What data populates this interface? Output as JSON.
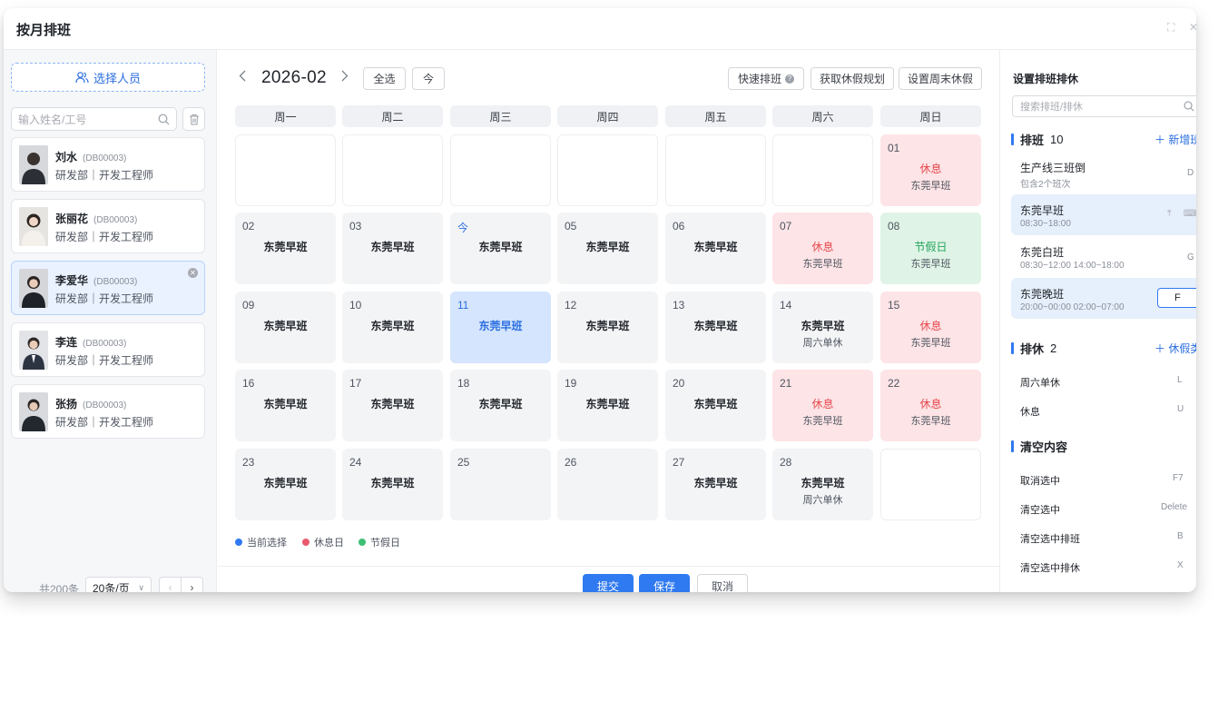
{
  "title": "按月排班",
  "left": {
    "pick_label": "选择人员",
    "search_placeholder": "输入姓名/工号",
    "people": [
      {
        "name": "刘水",
        "code": "(DB00003)",
        "dept": "研发部｜开发工程师"
      },
      {
        "name": "张丽花",
        "code": "(DB00003)",
        "dept": "研发部｜开发工程师"
      },
      {
        "name": "李爱华",
        "code": "(DB00003)",
        "dept": "研发部｜开发工程师"
      },
      {
        "name": "李连",
        "code": "(DB00003)",
        "dept": "研发部｜开发工程师"
      },
      {
        "name": "张扬",
        "code": "(DB00003)",
        "dept": "研发部｜开发工程师"
      }
    ],
    "total": "共200条",
    "per_page": "20条/页"
  },
  "calendar": {
    "month": "2026-02",
    "select_all": "全选",
    "today": "今",
    "quick": "快速排班",
    "get_holiday": "获取休假规划",
    "set_weekend": "设置周末休假",
    "weekdays": [
      "周一",
      "周二",
      "周三",
      "周四",
      "周五",
      "周六",
      "周日"
    ],
    "cells": [
      {
        "date": "",
        "main": "",
        "sub": ""
      },
      {
        "date": "",
        "main": "",
        "sub": ""
      },
      {
        "date": "",
        "main": "",
        "sub": ""
      },
      {
        "date": "",
        "main": "",
        "sub": ""
      },
      {
        "date": "",
        "main": "",
        "sub": ""
      },
      {
        "date": "",
        "main": "",
        "sub": ""
      },
      {
        "date": "01",
        "main": "休息",
        "sub": "东莞早班"
      },
      {
        "date": "02",
        "main": "东莞早班",
        "sub": ""
      },
      {
        "date": "03",
        "main": "东莞早班",
        "sub": ""
      },
      {
        "date": "今",
        "main": "东莞早班",
        "sub": ""
      },
      {
        "date": "05",
        "main": "东莞早班",
        "sub": ""
      },
      {
        "date": "06",
        "main": "东莞早班",
        "sub": ""
      },
      {
        "date": "07",
        "main": "休息",
        "sub": "东莞早班"
      },
      {
        "date": "08",
        "main": "节假日",
        "sub": "东莞早班"
      },
      {
        "date": "09",
        "main": "东莞早班",
        "sub": ""
      },
      {
        "date": "10",
        "main": "东莞早班",
        "sub": ""
      },
      {
        "date": "11",
        "main": "东莞早班",
        "sub": ""
      },
      {
        "date": "12",
        "main": "东莞早班",
        "sub": ""
      },
      {
        "date": "13",
        "main": "东莞早班",
        "sub": ""
      },
      {
        "date": "14",
        "main": "东莞早班",
        "sub": "周六单休"
      },
      {
        "date": "15",
        "main": "休息",
        "sub": "东莞早班"
      },
      {
        "date": "16",
        "main": "东莞早班",
        "sub": ""
      },
      {
        "date": "17",
        "main": "东莞早班",
        "sub": ""
      },
      {
        "date": "18",
        "main": "东莞早班",
        "sub": ""
      },
      {
        "date": "19",
        "main": "东莞早班",
        "sub": ""
      },
      {
        "date": "20",
        "main": "东莞早班",
        "sub": ""
      },
      {
        "date": "21",
        "main": "休息",
        "sub": "东莞早班"
      },
      {
        "date": "22",
        "main": "休息",
        "sub": "东莞早班"
      },
      {
        "date": "23",
        "main": "东莞早班",
        "sub": ""
      },
      {
        "date": "24",
        "main": "东莞早班",
        "sub": ""
      },
      {
        "date": "25",
        "main": "",
        "sub": ""
      },
      {
        "date": "26",
        "main": "",
        "sub": ""
      },
      {
        "date": "27",
        "main": "东莞早班",
        "sub": ""
      },
      {
        "date": "28",
        "main": "东莞早班",
        "sub": "周六单休"
      },
      {
        "date": "",
        "main": "",
        "sub": ""
      }
    ],
    "legend": [
      "当前选择",
      "休息日",
      "节假日"
    ],
    "legend_colors": [
      "#2f7af0",
      "#e85a6c",
      "#3cbf72"
    ]
  },
  "footer": {
    "submit": "提交",
    "save": "保存",
    "cancel": "取消"
  },
  "right": {
    "title": "设置排班排休",
    "search_placeholder": "搜索排班/排休",
    "shift_section": "排班",
    "shift_count": "10",
    "add_shift": "新增班",
    "shifts": [
      {
        "name": "生产线三班倒",
        "sub": "包含2个班次",
        "key": "D"
      },
      {
        "name": "东莞早班",
        "sub": "08:30~18:00",
        "key": ""
      },
      {
        "name": "东莞白班",
        "sub": "08:30~12:00 14:00~18:00",
        "key": "G"
      },
      {
        "name": "东莞晚班",
        "sub": "20:00~00:00 02:00~07:00",
        "key": "F"
      }
    ],
    "rest_section": "排休",
    "rest_count": "2",
    "add_rest": "休假类",
    "rests": [
      {
        "name": "周六单休",
        "key": "L"
      },
      {
        "name": "休息",
        "key": "U"
      }
    ],
    "clear_section": "清空内容",
    "clears": [
      {
        "name": "取消选中",
        "key": "F7"
      },
      {
        "name": "清空选中",
        "key": "Delete"
      },
      {
        "name": "清空选中排班",
        "key": "B"
      },
      {
        "name": "清空选中排休",
        "key": "X"
      }
    ]
  }
}
